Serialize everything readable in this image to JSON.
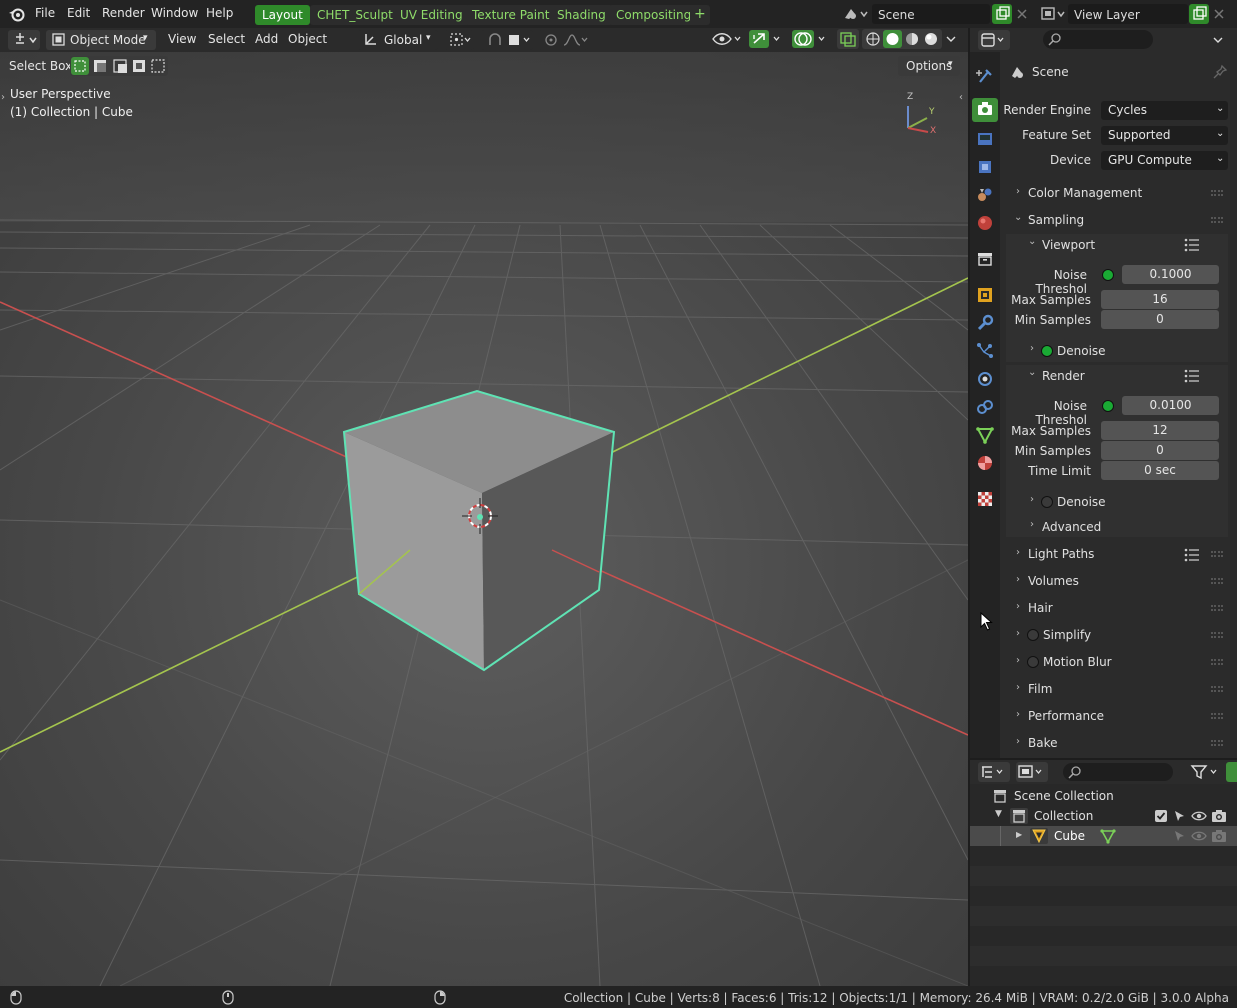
{
  "top_menu": {
    "items": [
      "File",
      "Edit",
      "Render",
      "Window",
      "Help"
    ]
  },
  "workspaces": {
    "tabs": [
      "Layout",
      "CHET_Sculpt",
      "UV Editing",
      "Texture Paint",
      "Shading",
      "Compositing"
    ],
    "active": "Layout"
  },
  "scene_selector": {
    "value": "Scene"
  },
  "view_layer_selector": {
    "value": "View Layer"
  },
  "viewport_header": {
    "mode": "Object Mode",
    "menus": [
      "View",
      "Select",
      "Add",
      "Object"
    ],
    "transform_orientation": "Global"
  },
  "tool_header": {
    "tool_name": "Select Box",
    "options_label": "Options"
  },
  "viewport": {
    "perspective_label": "User Perspective",
    "collection_label": "(1) Collection | Cube",
    "gizmo_axes": [
      "Z",
      "Y",
      "X"
    ]
  },
  "properties": {
    "context_title": "Scene",
    "render_engine_label": "Render Engine",
    "render_engine": "Cycles",
    "feature_set_label": "Feature Set",
    "feature_set": "Supported",
    "device_label": "Device",
    "device": "GPU Compute",
    "color_management": "Color Management",
    "sampling": "Sampling",
    "viewport_section": {
      "title": "Viewport",
      "noise_threshold_label": "Noise Threshol",
      "noise_threshold_value": "0.1000",
      "noise_threshold_enabled": true,
      "max_samples_label": "Max Samples",
      "max_samples_value": "16",
      "min_samples_label": "Min Samples",
      "min_samples_value": "0",
      "denoise_label": "Denoise",
      "denoise_enabled": true
    },
    "render_section": {
      "title": "Render",
      "noise_threshold_label": "Noise Threshol",
      "noise_threshold_value": "0.0100",
      "noise_threshold_enabled": true,
      "max_samples_label": "Max Samples",
      "max_samples_value": "12",
      "min_samples_label": "Min Samples",
      "min_samples_value": "0",
      "time_limit_label": "Time Limit",
      "time_limit_value": "0 sec",
      "denoise_label": "Denoise",
      "denoise_enabled": false,
      "advanced_label": "Advanced"
    },
    "collapsed_panels": [
      "Light Paths",
      "Volumes",
      "Hair",
      "Simplify",
      "Motion Blur",
      "Film",
      "Performance",
      "Bake"
    ]
  },
  "outliner": {
    "scene_collection": "Scene Collection",
    "collection": "Collection",
    "object": "Cube"
  },
  "status_bar": {
    "text": "Collection | Cube | Verts:8 | Faces:6 | Tris:12 | Objects:1/1 | Memory: 26.4 MiB | VRAM: 0.2/2.0 GiB | 3.0.0 Alpha"
  },
  "colors": {
    "accent_green": "#3f8f3a",
    "selection_outline": "#5fe3b4",
    "x_axis": "#c8504f",
    "y_axis": "#a4c44e"
  }
}
